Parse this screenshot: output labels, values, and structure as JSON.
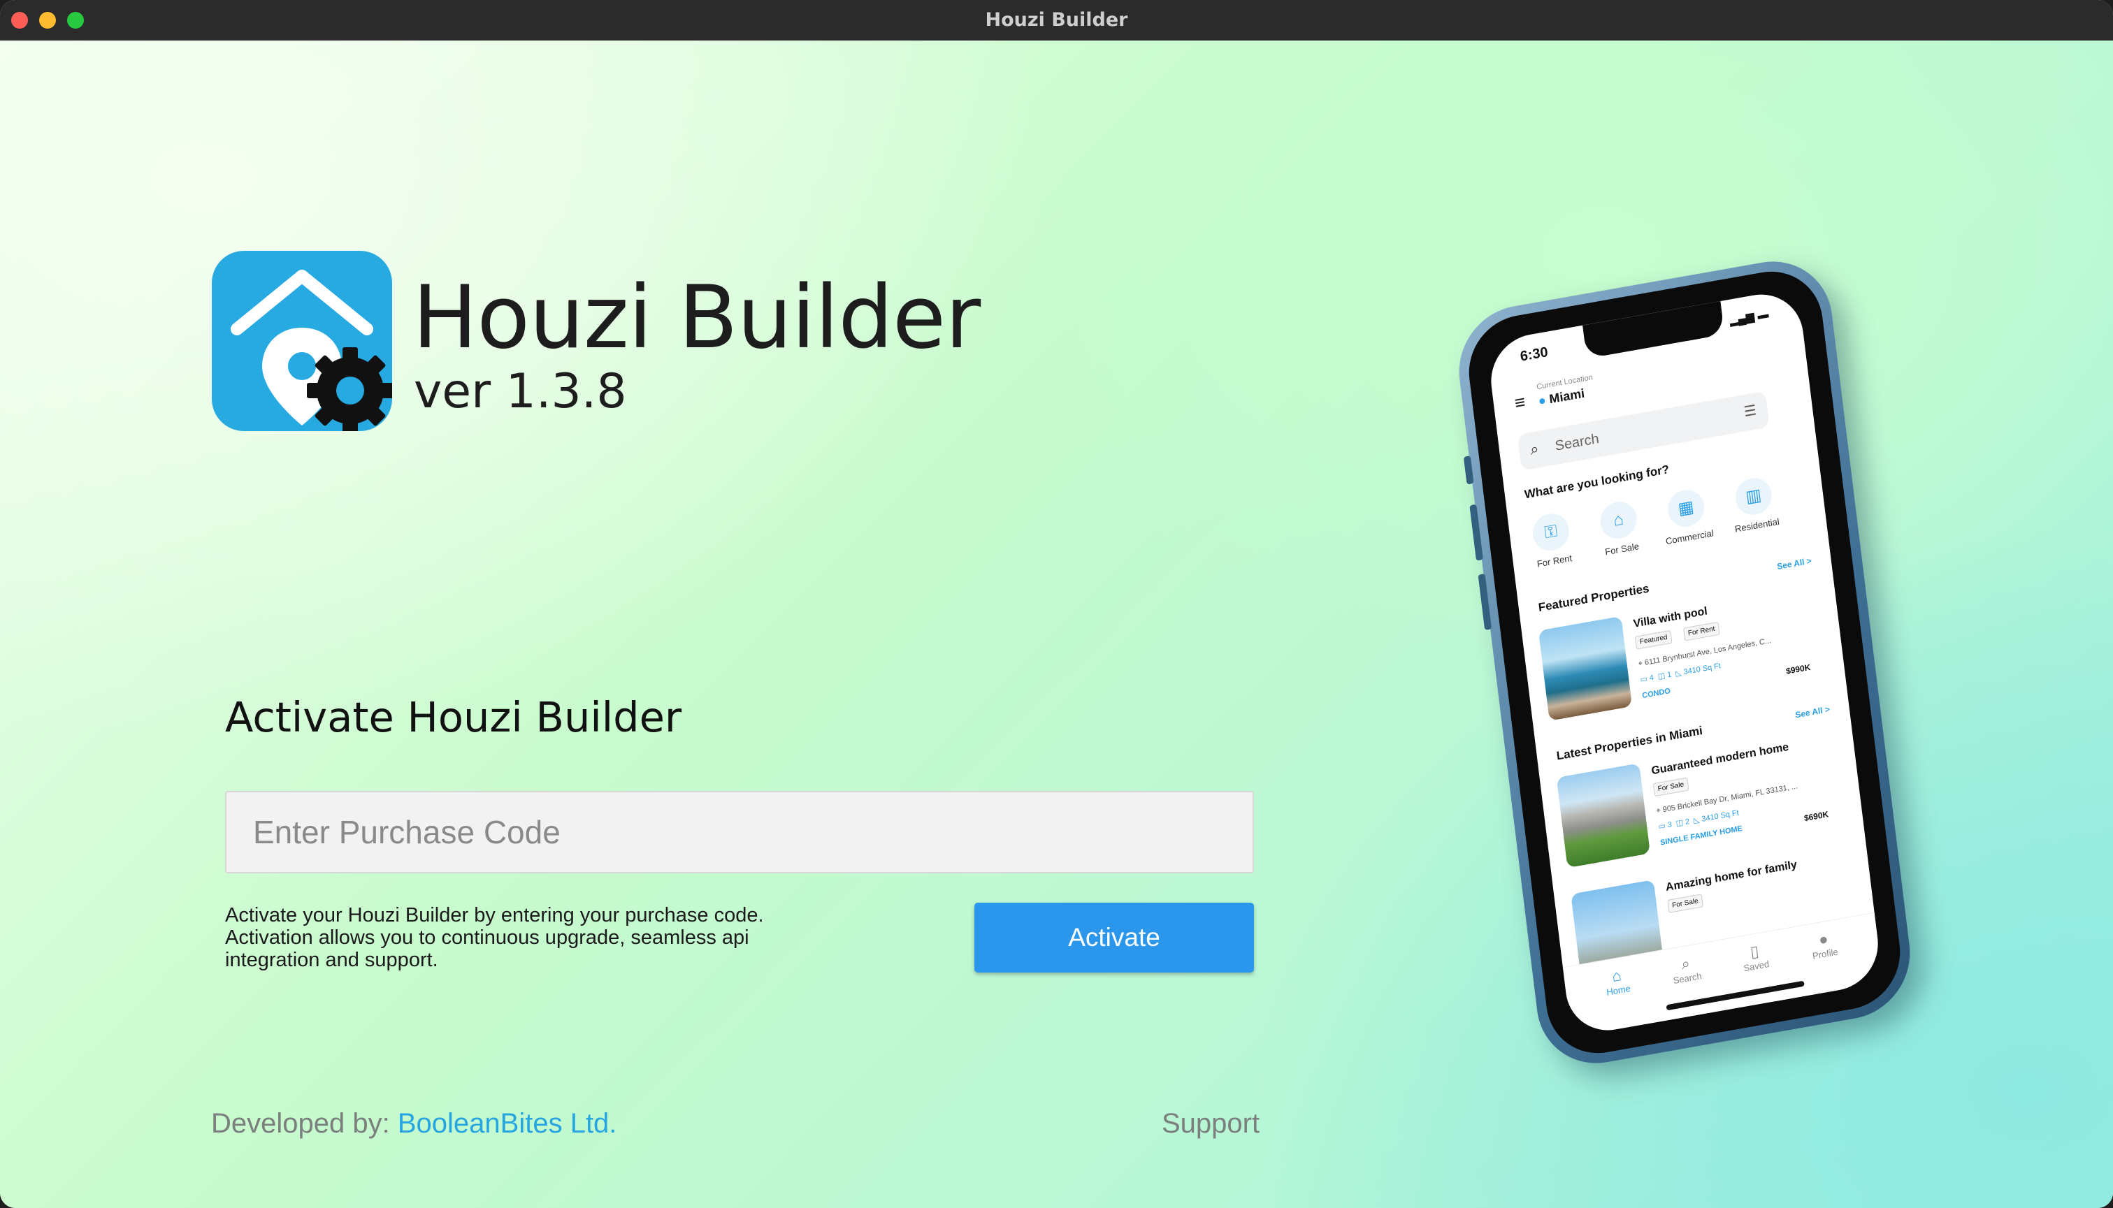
{
  "window": {
    "title": "Houzi Builder"
  },
  "brand": {
    "name": "Houzi Builder",
    "version": "ver 1.3.8",
    "logo_icon": "house-location-gear-icon",
    "logo_color": "#27a9e1"
  },
  "activation": {
    "title": "Activate Houzi Builder",
    "input_placeholder": "Enter Purchase Code",
    "input_value": "",
    "description": "Activate your Houzi Builder by entering your purchase code. Activation allows you to continuous upgrade, seamless api integration and support.",
    "button_label": "Activate",
    "button_color": "#2a97ec"
  },
  "footer": {
    "developed_by_label": "Developed by:",
    "developer_name": "BooleanBites Ltd.",
    "support_label": "Support"
  },
  "phone_preview": {
    "time": "6:30",
    "location_label": "Current Location",
    "location": "Miami",
    "search_placeholder": "Search",
    "section_looking": "What are you looking for?",
    "categories": [
      {
        "label": "For Rent",
        "icon": "key-icon"
      },
      {
        "label": "For Sale",
        "icon": "house-icon"
      },
      {
        "label": "Commercial",
        "icon": "store-icon"
      },
      {
        "label": "Residential",
        "icon": "building-icon"
      }
    ],
    "featured_title": "Featured Properties",
    "see_all": "See All >",
    "featured_card": {
      "title": "Villa with pool",
      "tags": [
        "Featured",
        "For Rent"
      ],
      "address": "6111 Brynhurst Ave, Los Angeles, C...",
      "beds": "4",
      "baths": "1",
      "area": "3410 Sq Ft",
      "type": "CONDO",
      "price": "$990K"
    },
    "latest_title": "Latest Properties in Miami",
    "latest_card": {
      "title": "Guaranteed modern home",
      "tags": [
        "For Sale"
      ],
      "address": "905 Brickell Bay Dr, Miami, FL 33131, ...",
      "beds": "3",
      "baths": "2",
      "area": "3410 Sq Ft",
      "type": "SINGLE FAMILY HOME",
      "price": "$690K"
    },
    "latest_card_2": {
      "title": "Amazing home for family",
      "tags": [
        "For Sale"
      ]
    },
    "tabs": [
      {
        "label": "Home",
        "icon": "home-icon"
      },
      {
        "label": "Search",
        "icon": "search-icon"
      },
      {
        "label": "Saved",
        "icon": "bookmark-icon"
      },
      {
        "label": "Profile",
        "icon": "profile-icon"
      }
    ]
  }
}
